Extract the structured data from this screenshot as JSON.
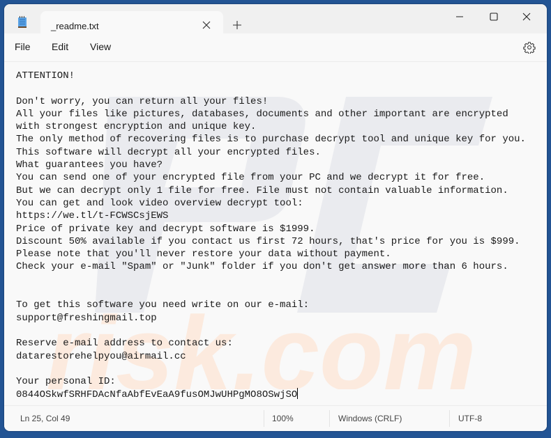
{
  "window": {
    "app_icon": "notepad-icon",
    "tab_title": "_readme.txt",
    "tab_close_icon": "close-icon",
    "new_tab_icon": "plus-icon",
    "controls": {
      "minimize_icon": "minimize-icon",
      "maximize_icon": "maximize-icon",
      "close_icon": "close-icon"
    }
  },
  "menu": {
    "items": [
      {
        "label": "File"
      },
      {
        "label": "Edit"
      },
      {
        "label": "View"
      }
    ],
    "settings_icon": "gear-icon"
  },
  "editor": {
    "lines": [
      "ATTENTION!",
      "",
      "Don't worry, you can return all your files!",
      "All your files like pictures, databases, documents and other important are encrypted",
      "with strongest encryption and unique key.",
      "The only method of recovering files is to purchase decrypt tool and unique key for you.",
      "This software will decrypt all your encrypted files.",
      "What guarantees you have?",
      "You can send one of your encrypted file from your PC and we decrypt it for free.",
      "But we can decrypt only 1 file for free. File must not contain valuable information.",
      "You can get and look video overview decrypt tool:",
      "https://we.tl/t-FCWSCsjEWS",
      "Price of private key and decrypt software is $1999.",
      "Discount 50% available if you contact us first 72 hours, that's price for you is $999.",
      "Please note that you'll never restore your data without payment.",
      "Check your e-mail \"Spam\" or \"Junk\" folder if you don't get answer more than 6 hours.",
      "",
      "",
      "To get this software you need write on our e-mail:",
      "support@freshingmail.top",
      "",
      "Reserve e-mail address to contact us:",
      "datarestorehelpyou@airmail.cc",
      "",
      "Your personal ID:",
      "0844OSkwfSRHFDAcNfaAbfEvEaA9fusOMJwUHPgMO8OSwjSO"
    ]
  },
  "status": {
    "position": "Ln 25, Col 49",
    "zoom": "100%",
    "line_ending": "Windows (CRLF)",
    "encoding": "UTF-8"
  },
  "colors": {
    "frame_background": "#235494",
    "window_background": "#f9f9f9",
    "titlebar_background": "#f0f0f0",
    "text": "#1a1a1a",
    "watermark_gray": "#e9eaee",
    "watermark_orange": "#fbe9de"
  }
}
